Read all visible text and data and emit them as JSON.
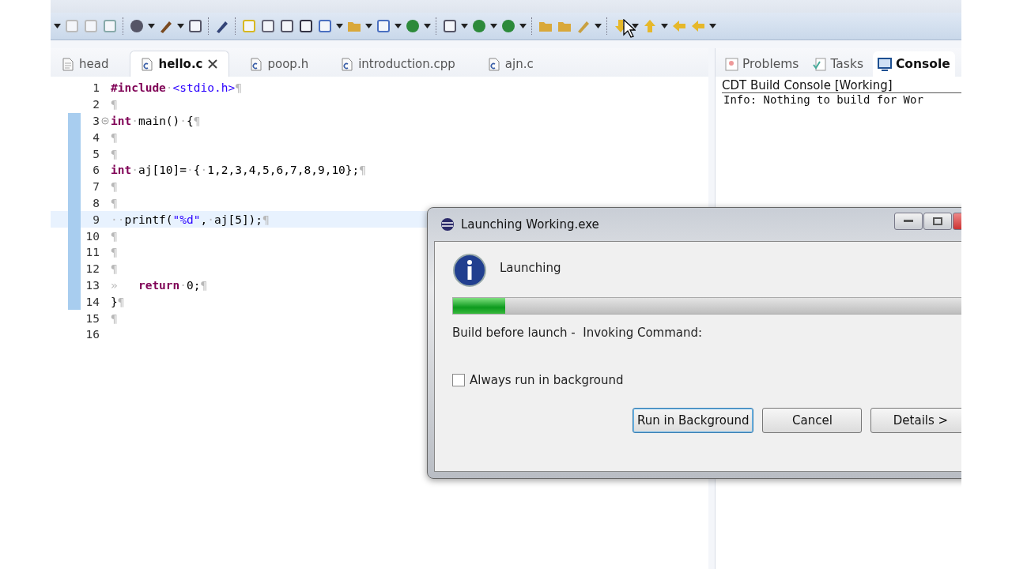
{
  "editor_tabs": [
    {
      "label": "head",
      "kind": "file",
      "selected": false
    },
    {
      "label": "hello.c",
      "kind": "c",
      "selected": true
    },
    {
      "label": "poop.h",
      "kind": "c",
      "selected": false
    },
    {
      "label": "introduction.cpp",
      "kind": "c",
      "selected": false
    },
    {
      "label": "ajn.c",
      "kind": "c",
      "selected": false
    }
  ],
  "code_lines": [
    {
      "number": "1",
      "changed": false,
      "current": false,
      "tokens": [
        {
          "kind": "keyword",
          "text": "#include"
        },
        {
          "kind": "mark",
          "text": "·"
        },
        {
          "kind": "string",
          "text": "<stdio.h>"
        },
        {
          "kind": "mark",
          "text": "¶"
        }
      ]
    },
    {
      "number": "2",
      "changed": false,
      "current": false,
      "tokens": [
        {
          "kind": "mark",
          "text": "¶"
        }
      ]
    },
    {
      "number": "3",
      "changed": true,
      "current": false,
      "fold": true,
      "tokens": [
        {
          "kind": "keyword",
          "text": "int"
        },
        {
          "kind": "mark",
          "text": "·"
        },
        {
          "kind": "plain",
          "text": "main()"
        },
        {
          "kind": "mark",
          "text": "·"
        },
        {
          "kind": "plain",
          "text": "{"
        },
        {
          "kind": "mark",
          "text": "¶"
        }
      ]
    },
    {
      "number": "4",
      "changed": true,
      "current": false,
      "tokens": [
        {
          "kind": "mark",
          "text": "¶"
        }
      ]
    },
    {
      "number": "5",
      "changed": true,
      "current": false,
      "tokens": [
        {
          "kind": "mark",
          "text": "¶"
        }
      ]
    },
    {
      "number": "6",
      "changed": true,
      "current": false,
      "tokens": [
        {
          "kind": "keyword",
          "text": "int"
        },
        {
          "kind": "mark",
          "text": "·"
        },
        {
          "kind": "plain",
          "text": "aj[10]="
        },
        {
          "kind": "mark",
          "text": "·"
        },
        {
          "kind": "plain",
          "text": "{"
        },
        {
          "kind": "mark",
          "text": "·"
        },
        {
          "kind": "plain",
          "text": "1,2,3,4,5,6,7,8,9,10};"
        },
        {
          "kind": "mark",
          "text": "¶"
        }
      ]
    },
    {
      "number": "7",
      "changed": true,
      "current": false,
      "tokens": [
        {
          "kind": "mark",
          "text": "¶"
        }
      ]
    },
    {
      "number": "8",
      "changed": true,
      "current": false,
      "tokens": [
        {
          "kind": "mark",
          "text": "¶"
        }
      ]
    },
    {
      "number": "9",
      "changed": true,
      "current": true,
      "tokens": [
        {
          "kind": "mark",
          "text": "··"
        },
        {
          "kind": "plain",
          "text": "printf("
        },
        {
          "kind": "string",
          "text": "\"%d\""
        },
        {
          "kind": "plain",
          "text": ","
        },
        {
          "kind": "mark",
          "text": "·"
        },
        {
          "kind": "plain",
          "text": "aj[5]);"
        },
        {
          "kind": "mark",
          "text": "¶"
        }
      ]
    },
    {
      "number": "10",
      "changed": true,
      "current": false,
      "tokens": [
        {
          "kind": "mark",
          "text": "¶"
        }
      ]
    },
    {
      "number": "11",
      "changed": true,
      "current": false,
      "tokens": [
        {
          "kind": "mark",
          "text": "¶"
        }
      ]
    },
    {
      "number": "12",
      "changed": true,
      "current": false,
      "tokens": [
        {
          "kind": "mark",
          "text": "¶"
        }
      ]
    },
    {
      "number": "13",
      "changed": true,
      "current": false,
      "tokens": [
        {
          "kind": "mark",
          "text": "»   "
        },
        {
          "kind": "keyword",
          "text": "return"
        },
        {
          "kind": "mark",
          "text": "·"
        },
        {
          "kind": "plain",
          "text": "0;"
        },
        {
          "kind": "mark",
          "text": "¶"
        }
      ]
    },
    {
      "number": "14",
      "changed": true,
      "current": false,
      "tokens": [
        {
          "kind": "plain",
          "text": "}"
        },
        {
          "kind": "mark",
          "text": "¶"
        }
      ]
    },
    {
      "number": "15",
      "changed": false,
      "current": false,
      "tokens": [
        {
          "kind": "mark",
          "text": "¶"
        }
      ]
    },
    {
      "number": "16",
      "changed": false,
      "current": false
    }
  ],
  "view_tabs": [
    {
      "label": "Problems",
      "kind": "problems",
      "selected": false
    },
    {
      "label": "Tasks",
      "kind": "tasks",
      "selected": false
    },
    {
      "label": "Console",
      "kind": "console",
      "selected": true
    }
  ],
  "console": {
    "title": "CDT Build Console [Working]",
    "lines": [
      "Info: Nothing to build for Wor"
    ]
  },
  "dialog": {
    "title": "Launching Working.exe",
    "heading": "Launching",
    "progress": {
      "level": 0.095
    },
    "status": "Build before launch -  Invoking Command:",
    "checkbox": {
      "label": "Always run in background",
      "checked": false
    },
    "buttons": [
      {
        "label": "Run in Background",
        "selected": true
      },
      {
        "label": "Cancel",
        "selected": false
      },
      {
        "label": "Details >",
        "selected": false
      }
    ]
  }
}
